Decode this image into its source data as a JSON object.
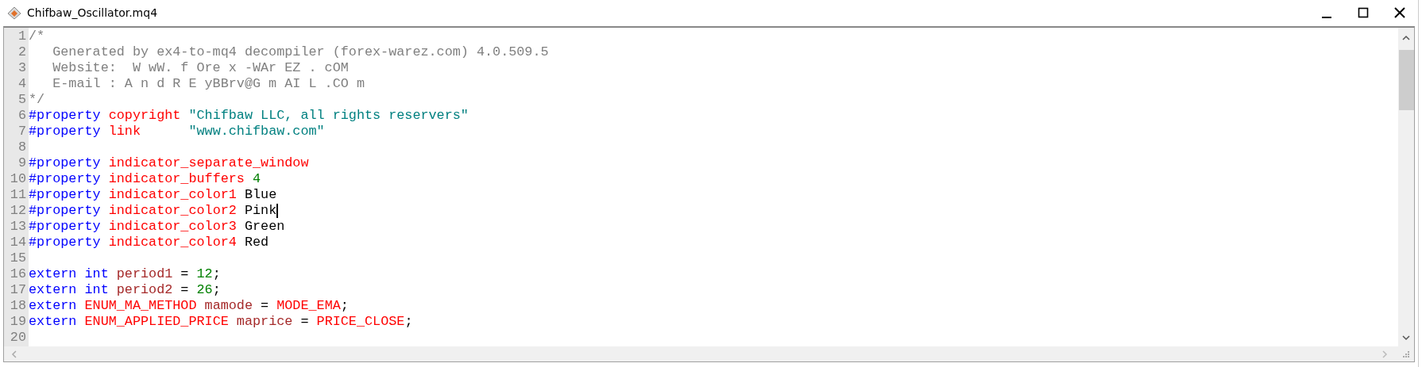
{
  "window": {
    "title": "Chifbaw_Oscillator.mq4"
  },
  "editor": {
    "lines": [
      {
        "number": "1",
        "tokens": [
          {
            "text": "/*",
            "kind": "comment"
          }
        ]
      },
      {
        "number": "2",
        "tokens": [
          {
            "text": "   Generated by ex4-to-mq4 decompiler (forex-warez.com) 4.0.509.5",
            "kind": "comment"
          }
        ]
      },
      {
        "number": "3",
        "tokens": [
          {
            "text": "   Website:  W wW. f Ore x -WAr EZ . cOM",
            "kind": "comment"
          }
        ]
      },
      {
        "number": "4",
        "tokens": [
          {
            "text": "   E-mail : A n d R E yBBrv@G m AI L .CO m",
            "kind": "comment"
          }
        ]
      },
      {
        "number": "5",
        "tokens": [
          {
            "text": "*/",
            "kind": "comment"
          }
        ]
      },
      {
        "number": "6",
        "tokens": [
          {
            "text": "#property",
            "kind": "keyword"
          },
          {
            "text": " copyright",
            "kind": "property"
          },
          {
            "text": " \"Chifbaw LLC, all rights reservers\"",
            "kind": "string"
          }
        ]
      },
      {
        "number": "7",
        "tokens": [
          {
            "text": "#property",
            "kind": "keyword"
          },
          {
            "text": " link",
            "kind": "property"
          },
          {
            "text": "      \"www.chifbaw.com\"",
            "kind": "string"
          }
        ]
      },
      {
        "number": "8"
      },
      {
        "number": "9",
        "tokens": [
          {
            "text": "#property",
            "kind": "keyword"
          },
          {
            "text": " indicator_separate_window",
            "kind": "property"
          }
        ]
      },
      {
        "number": "10",
        "tokens": [
          {
            "text": "#property",
            "kind": "keyword"
          },
          {
            "text": " indicator_buffers",
            "kind": "property"
          },
          {
            "text": " 4",
            "kind": "number"
          }
        ]
      },
      {
        "number": "11",
        "tokens": [
          {
            "text": "#property",
            "kind": "keyword"
          },
          {
            "text": " indicator_color1",
            "kind": "property"
          },
          {
            "text": " Blue",
            "kind": "plain"
          }
        ]
      },
      {
        "number": "12",
        "tokens": [
          {
            "text": "#property",
            "kind": "keyword"
          },
          {
            "text": " indicator_color2",
            "kind": "property"
          },
          {
            "text": " Pink",
            "kind": "plain",
            "caret": true
          }
        ]
      },
      {
        "number": "13",
        "tokens": [
          {
            "text": "#property",
            "kind": "keyword"
          },
          {
            "text": " indicator_color3",
            "kind": "property"
          },
          {
            "text": " Green",
            "kind": "plain"
          }
        ]
      },
      {
        "number": "14",
        "tokens": [
          {
            "text": "#property",
            "kind": "keyword"
          },
          {
            "text": " indicator_color4",
            "kind": "property"
          },
          {
            "text": " Red",
            "kind": "plain"
          }
        ]
      },
      {
        "number": "15"
      },
      {
        "number": "16",
        "tokens": [
          {
            "text": "extern int",
            "kind": "keyword"
          },
          {
            "text": " period1",
            "kind": "identifier"
          },
          {
            "text": " =",
            "kind": "plain"
          },
          {
            "text": " 12",
            "kind": "number"
          },
          {
            "text": ";",
            "kind": "plain"
          }
        ]
      },
      {
        "number": "17",
        "tokens": [
          {
            "text": "extern int",
            "kind": "keyword"
          },
          {
            "text": " period2",
            "kind": "identifier"
          },
          {
            "text": " =",
            "kind": "plain"
          },
          {
            "text": " 26",
            "kind": "number"
          },
          {
            "text": ";",
            "kind": "plain"
          }
        ]
      },
      {
        "number": "18",
        "tokens": [
          {
            "text": "extern",
            "kind": "keyword"
          },
          {
            "text": " ENUM_MA_METHOD",
            "kind": "property"
          },
          {
            "text": " mamode",
            "kind": "identifier"
          },
          {
            "text": " =",
            "kind": "plain"
          },
          {
            "text": " MODE_EMA",
            "kind": "property"
          },
          {
            "text": ";",
            "kind": "plain"
          }
        ]
      },
      {
        "number": "19",
        "tokens": [
          {
            "text": "extern",
            "kind": "keyword"
          },
          {
            "text": " ENUM_APPLIED_PRICE",
            "kind": "property"
          },
          {
            "text": " maprice",
            "kind": "identifier"
          },
          {
            "text": " =",
            "kind": "plain"
          },
          {
            "text": " PRICE_CLOSE",
            "kind": "property"
          },
          {
            "text": ";",
            "kind": "plain"
          }
        ]
      },
      {
        "number": "20"
      }
    ]
  }
}
